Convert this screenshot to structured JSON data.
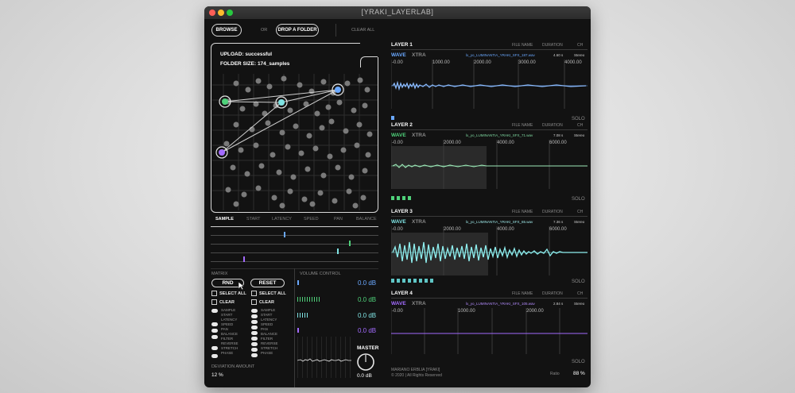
{
  "window": {
    "title": "[YRAKI_LAYERLAB]"
  },
  "toolbar": {
    "browse": "BROWSE",
    "or": "OR",
    "drop_folder": "DROP A FOLDER",
    "clear_all": "CLEAR ALL"
  },
  "upload": {
    "status": "UPLOAD: successful",
    "folder_size": "FOLDER SIZE: 174_samples"
  },
  "map_tabs": [
    "SAMPLE",
    "START",
    "LATENCY",
    "SPEED",
    "PAN",
    "BALANCE"
  ],
  "matrix": {
    "label": "MATRIX",
    "rnd": "RND",
    "reset": "RESET",
    "select_all": "SELECT ALL",
    "clear": "CLEAR",
    "params": [
      "SAMPLE",
      "START",
      "LATENCY",
      "SPEED",
      "PAN",
      "BALANCE",
      "FILTER",
      "REVERSE",
      "STRETCH",
      "PHASE"
    ],
    "deviation_label": "DEVIATION AMOUNT",
    "deviation_value": "12 %"
  },
  "volume": {
    "label": "VOLUME CONTROL",
    "values": [
      "0.0 dB",
      "0.0 dB",
      "0.0 dB",
      "0.0 dB"
    ],
    "master_label": "MASTER",
    "master_value": "0.0 dB"
  },
  "layer_headers": {
    "file_name": "FILE NAME",
    "duration": "DURATION",
    "ch": "CH",
    "wave": "WAVE",
    "xtra": "XTRA",
    "solo": "SOLO"
  },
  "layers": [
    {
      "title": "LAYER 1",
      "file": "lx_yo_LUMINANTIA_YRAKI_SFX_187.wav",
      "duration": "4.60 s",
      "channels": "Stereo",
      "ticks": [
        "-0.00",
        "1000.00",
        "2000.00",
        "3000.00",
        "4000.00"
      ],
      "color": "#6aa8ff"
    },
    {
      "title": "LAYER 2",
      "file": "lx_yo_LUMINANTIA_YRAKI_SFX_71.wav",
      "duration": "7.08 s",
      "channels": "Stereo",
      "ticks": [
        "-0.00",
        "2000.00",
        "4000.00",
        "6000.00"
      ],
      "color": "#7ed9a0"
    },
    {
      "title": "LAYER 3",
      "file": "lx_yo_LUMINANTIA_YRAKI_SFX_65.wav",
      "duration": "7.36 s",
      "channels": "Stereo",
      "ticks": [
        "-0.00",
        "2000.00",
        "4000.00",
        "6000.00"
      ],
      "color": "#7fe3e3"
    },
    {
      "title": "LAYER 4",
      "file": "lx_yo_LUMINANTIA_YRAKI_SFX_105.wav",
      "duration": "2.84 s",
      "channels": "Stereo",
      "ticks": [
        "-0.00",
        "1000.00",
        "2000.00"
      ],
      "color": "#a36bff"
    }
  ],
  "footer": {
    "credit": "MARIANO ERBLIA [YRAKI]",
    "copyright": "© 2020 | All Rights Reserved",
    "ratio_label": "Ratio",
    "ratio_value": "88 %"
  }
}
